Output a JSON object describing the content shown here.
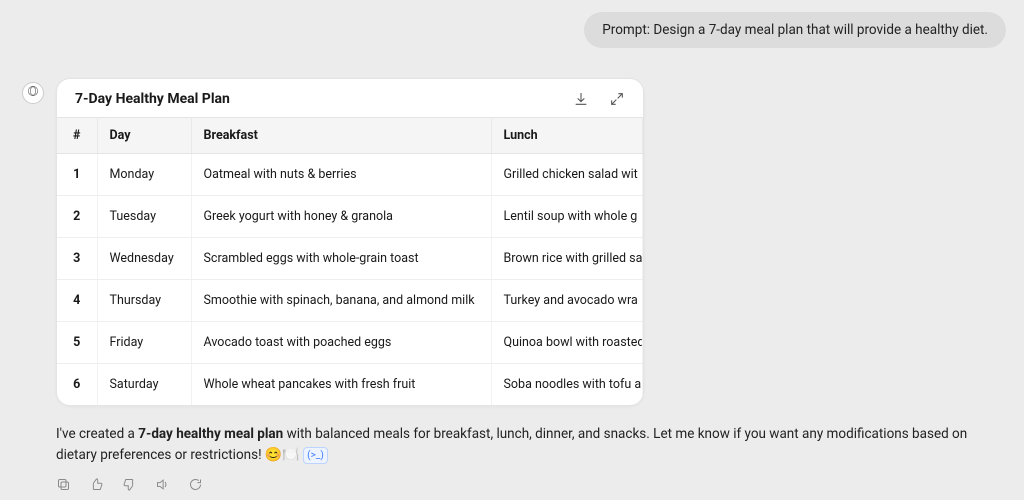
{
  "prompt": {
    "text": "Prompt: Design a 7-day meal plan that will provide a healthy diet."
  },
  "card": {
    "title": "7-Day Healthy Meal Plan",
    "columns": [
      "#",
      "Day",
      "Breakfast",
      "Lunch"
    ],
    "rows": [
      {
        "n": "1",
        "day": "Monday",
        "breakfast": "Oatmeal with nuts & berries",
        "lunch": "Grilled chicken salad wit"
      },
      {
        "n": "2",
        "day": "Tuesday",
        "breakfast": "Greek yogurt with honey & granola",
        "lunch": "Lentil soup with whole g"
      },
      {
        "n": "3",
        "day": "Wednesday",
        "breakfast": "Scrambled eggs with whole-grain toast",
        "lunch": "Brown rice with grilled sa"
      },
      {
        "n": "4",
        "day": "Thursday",
        "breakfast": "Smoothie with spinach, banana, and almond milk",
        "lunch": "Turkey and avocado wra"
      },
      {
        "n": "5",
        "day": "Friday",
        "breakfast": "Avocado toast with poached eggs",
        "lunch": "Quinoa bowl with roasted"
      },
      {
        "n": "6",
        "day": "Saturday",
        "breakfast": "Whole wheat pancakes with fresh fruit",
        "lunch": "Soba noodles with tofu a"
      }
    ]
  },
  "reply": {
    "pre": "I've created a ",
    "bold": "7-day healthy meal plan",
    "post": " with balanced meals for breakfast, lunch, dinner, and snacks. Let me know if you want any modifications based on dietary preferences or restrictions! ",
    "emoji": "😊🍽️",
    "badge": "(>_)"
  },
  "icons": {
    "download": "download-icon",
    "expand": "expand-icon",
    "copy": "copy-icon",
    "thumbs_up": "thumbs-up-icon",
    "thumbs_down": "thumbs-down-icon",
    "speak": "speaker-icon",
    "regenerate": "regenerate-icon"
  }
}
